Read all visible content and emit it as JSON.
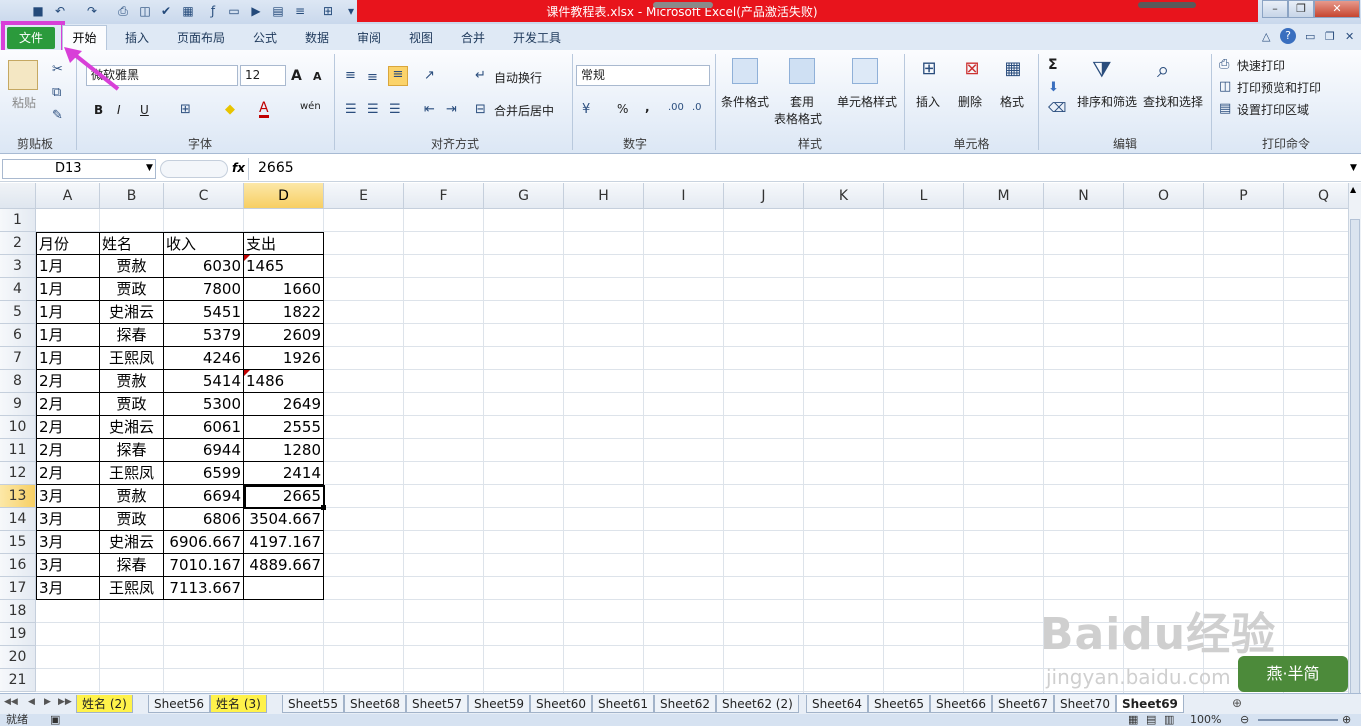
{
  "window": {
    "title": "课件教程表.xlsx  -  Microsoft Excel(产品激活失败)",
    "title_color": "#e8141c"
  },
  "ribbon_tabs": {
    "file": "文件",
    "home": "开始",
    "insert": "插入",
    "layout": "页面布局",
    "formula": "公式",
    "data": "数据",
    "review": "审阅",
    "view": "视图",
    "merge": "合并",
    "developer": "开发工具"
  },
  "clipboard": {
    "paste": "粘贴",
    "label": "剪贴板"
  },
  "font": {
    "name": "微软雅黑",
    "size": "12",
    "label": "字体",
    "grow": "A",
    "shrink": "A",
    "bold": "B",
    "italic": "I",
    "underline": "U",
    "phonetic": "wén",
    "font_color": "A"
  },
  "alignment": {
    "wrap": "自动换行",
    "merge": "合并后居中",
    "label": "对齐方式"
  },
  "number": {
    "format": "常规",
    "label": "数字",
    "percent": "%",
    "comma": ","
  },
  "styles": {
    "cond": "条件格式",
    "table1": "套用",
    "table2": "表格格式",
    "cell": "单元格样式",
    "label": "样式"
  },
  "cells": {
    "insert": "插入",
    "delete": "删除",
    "format": "格式",
    "label": "单元格"
  },
  "editing": {
    "sum": "Σ",
    "sort": "排序和筛选",
    "find": "查找和选择",
    "label": "编辑"
  },
  "print": {
    "quick": "快速打印",
    "preview": "打印预览和打印",
    "area": "设置打印区域",
    "label": "打印命令"
  },
  "formula_bar": {
    "name_box": "D13",
    "fx": "fx",
    "value": "2665"
  },
  "columns": [
    "A",
    "B",
    "C",
    "D",
    "E",
    "F",
    "G",
    "H",
    "I",
    "J",
    "K",
    "L",
    "M",
    "N",
    "O",
    "P",
    "Q"
  ],
  "rows": [
    "1",
    "2",
    "3",
    "4",
    "5",
    "6",
    "7",
    "8",
    "9",
    "10",
    "11",
    "12",
    "13",
    "14",
    "15",
    "16",
    "17",
    "18",
    "19",
    "20",
    "21"
  ],
  "table": {
    "header": [
      "月份",
      "姓名",
      "收入",
      "支出"
    ],
    "rows": [
      [
        "1月",
        "贾赦",
        "6030",
        "1465"
      ],
      [
        "1月",
        "贾政",
        "7800",
        "1660"
      ],
      [
        "1月",
        "史湘云",
        "5451",
        "1822"
      ],
      [
        "1月",
        "探春",
        "5379",
        "2609"
      ],
      [
        "1月",
        "王熙凤",
        "4246",
        "1926"
      ],
      [
        "2月",
        "贾赦",
        "5414",
        "1486"
      ],
      [
        "2月",
        "贾政",
        "5300",
        "2649"
      ],
      [
        "2月",
        "史湘云",
        "6061",
        "2555"
      ],
      [
        "2月",
        "探春",
        "6944",
        "1280"
      ],
      [
        "2月",
        "王熙凤",
        "6599",
        "2414"
      ],
      [
        "3月",
        "贾赦",
        "6694",
        "2665"
      ],
      [
        "3月",
        "贾政",
        "6806",
        "3504.667"
      ],
      [
        "3月",
        "史湘云",
        "6906.667",
        "4197.167"
      ],
      [
        "3月",
        "探春",
        "7010.167",
        "4889.667"
      ],
      [
        "3月",
        "王熙凤",
        "7113.667",
        ""
      ]
    ]
  },
  "sheets": [
    "姓名 (2)",
    "Sheet56",
    "姓名 (3)",
    "Sheet55",
    "Sheet68",
    "Sheet57",
    "Sheet59",
    "Sheet60",
    "Sheet61",
    "Sheet62",
    "Sheet62 (2)",
    "Sheet64",
    "Sheet65",
    "Sheet66",
    "Sheet67",
    "Sheet70",
    "Sheet69"
  ],
  "status": {
    "ready": "就绪",
    "zoom": "100%"
  },
  "watermark": {
    "main": "Baidu经验",
    "sub": "jingyan.baidu.com",
    "badge": "燕·半简"
  }
}
